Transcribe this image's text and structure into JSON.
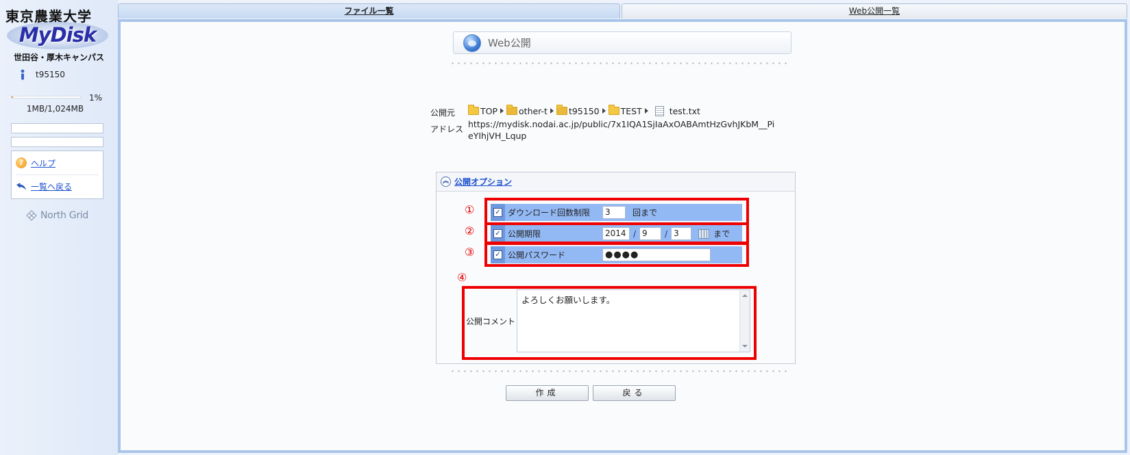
{
  "logo": {
    "university": "東京農業大学",
    "product": "MyDisk",
    "campus": "世田谷・厚木キャンパス"
  },
  "user": {
    "id": "t95150"
  },
  "usage": {
    "percent_label": "1%",
    "fraction": 0.01,
    "text": "1MB/1,024MB"
  },
  "sidebar_menu": {
    "help": "ヘルプ",
    "back_to_list": "一覧へ戻る"
  },
  "brand": {
    "northgrid": "North Grid"
  },
  "tabs": {
    "file_list": "ファイル一覧",
    "web_public_list": "Web公開一覧"
  },
  "page": {
    "title": "Web公開"
  },
  "source": {
    "label": "公開元",
    "path": [
      "TOP",
      "other-t",
      "t95150",
      "TEST"
    ],
    "file": "test.txt"
  },
  "address": {
    "label": "アドレス",
    "url": "https://mydisk.nodai.ac.jp/public/7x1IQA1SjIaAxOABAmtHzGvhJKbM__PieYIhjVH_Lqup"
  },
  "options": {
    "header": "公開オプション",
    "download_limit": {
      "marker": "①",
      "label": "ダウンロード回数制限",
      "value": "3",
      "suffix": "回まで"
    },
    "period": {
      "marker": "②",
      "label": "公開期限",
      "year": "2014",
      "month": "9",
      "day": "3",
      "suffix": "まで"
    },
    "password": {
      "marker": "③",
      "label": "公開パスワード",
      "value": "●●●●"
    },
    "comment": {
      "marker": "④",
      "label": "公開コメント",
      "value": "よろしくお願いします。"
    }
  },
  "buttons": {
    "create": "作成",
    "back": "戻る"
  },
  "colors": {
    "highlight": "#ee0000",
    "option_row": "#93b9f5",
    "link": "#1a4fd0"
  }
}
